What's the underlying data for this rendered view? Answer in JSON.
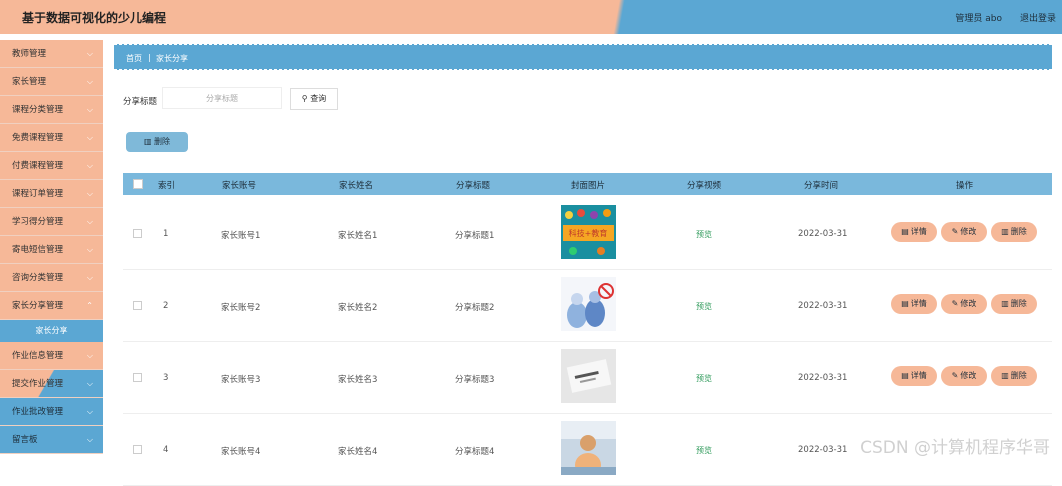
{
  "header": {
    "app_title": "基于数据可视化的少儿编程",
    "user": "管理员 abo",
    "logout": "退出登录"
  },
  "sidebar": {
    "items": [
      "教师管理",
      "家长管理",
      "课程分类管理",
      "免费课程管理",
      "付费课程管理",
      "课程订单管理",
      "学习得分管理",
      "寄电短信管理",
      "咨询分类管理",
      "家长分享管理"
    ],
    "sub_item": "家长分享",
    "items_after": [
      "作业信息管理",
      "提交作业管理",
      "作业批改管理",
      "留言板"
    ]
  },
  "breadcrumb": {
    "home": "首页",
    "current": "家长分享"
  },
  "search": {
    "label": "分享标题",
    "placeholder": "分享标题",
    "button": "查询"
  },
  "toolbar": {
    "delete_label": "删除"
  },
  "table": {
    "headers": [
      "索引",
      "家长账号",
      "家长姓名",
      "分享标题",
      "封面图片",
      "分享视频",
      "分享时间",
      "操作"
    ],
    "rows": [
      {
        "index": "1",
        "account": "家长账号1",
        "name": "家长姓名1",
        "title": "分享标题1",
        "video": "预览",
        "time": "2022-03-31"
      },
      {
        "index": "2",
        "account": "家长账号2",
        "name": "家长姓名2",
        "title": "分享标题2",
        "video": "预览",
        "time": "2022-03-31"
      },
      {
        "index": "3",
        "account": "家长账号3",
        "name": "家长姓名3",
        "title": "分享标题3",
        "video": "预览",
        "time": "2022-03-31"
      },
      {
        "index": "4",
        "account": "家长账号4",
        "name": "家长姓名4",
        "title": "分享标题4",
        "video": "预览",
        "time": "2022-03-31"
      }
    ],
    "actions": {
      "detail": "详情",
      "edit": "修改",
      "delete": "删除"
    },
    "thumb1_text": "科技+教育"
  },
  "watermark": "CSDN @计算机程序华哥",
  "colors": {
    "peach": "#f6b898",
    "blue": "#5ba7d3"
  }
}
